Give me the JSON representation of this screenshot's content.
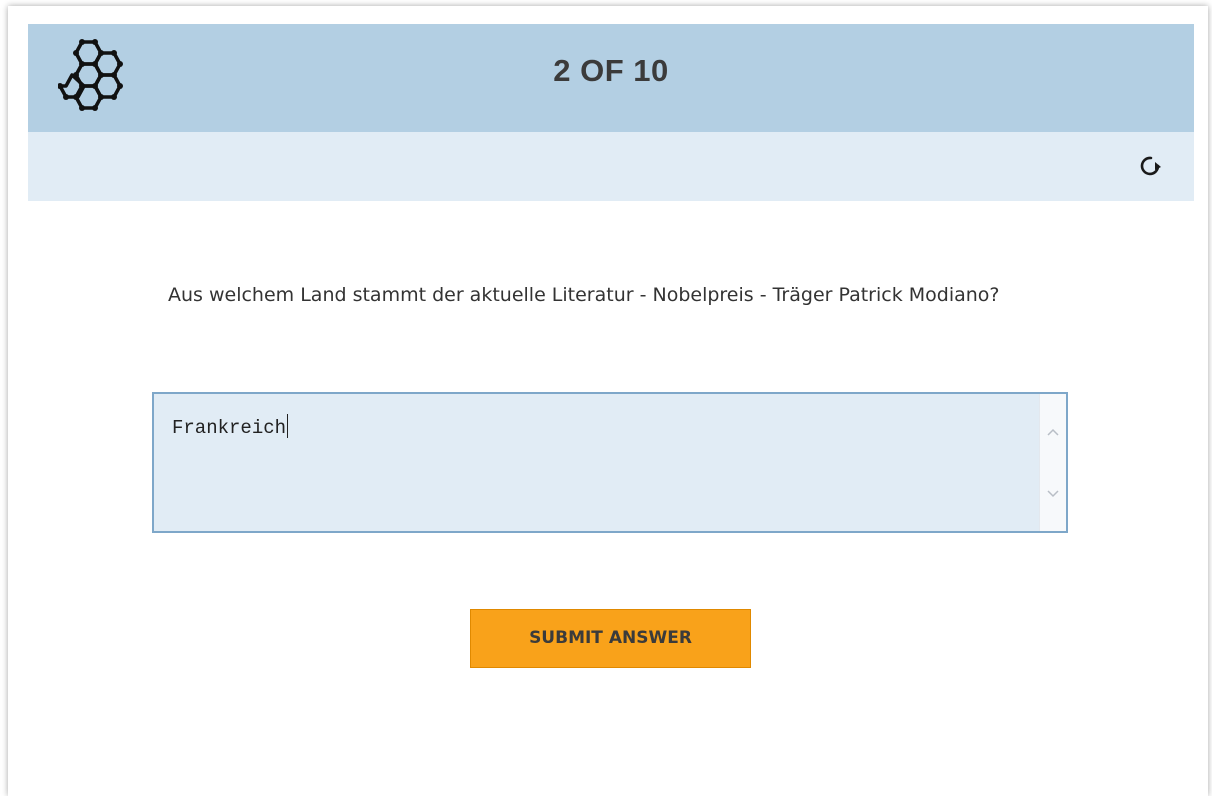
{
  "header": {
    "progress_text": "2 OF 10",
    "logo_icon": "hexagon-molecule-icon"
  },
  "toolbar": {
    "refresh_icon": "refresh-icon"
  },
  "question": {
    "text": "Aus welchem Land stammt der aktuelle Literatur - Nobelpreis - Träger Patrick Modiano?"
  },
  "answer": {
    "value": "Frankreich"
  },
  "actions": {
    "submit_label": "SUBMIT ANSWER"
  },
  "colors": {
    "header_bg": "#b3cfe3",
    "subbar_bg": "#e1ecf5",
    "input_bg": "#e1ecf5",
    "submit_bg": "#f9a21a"
  }
}
